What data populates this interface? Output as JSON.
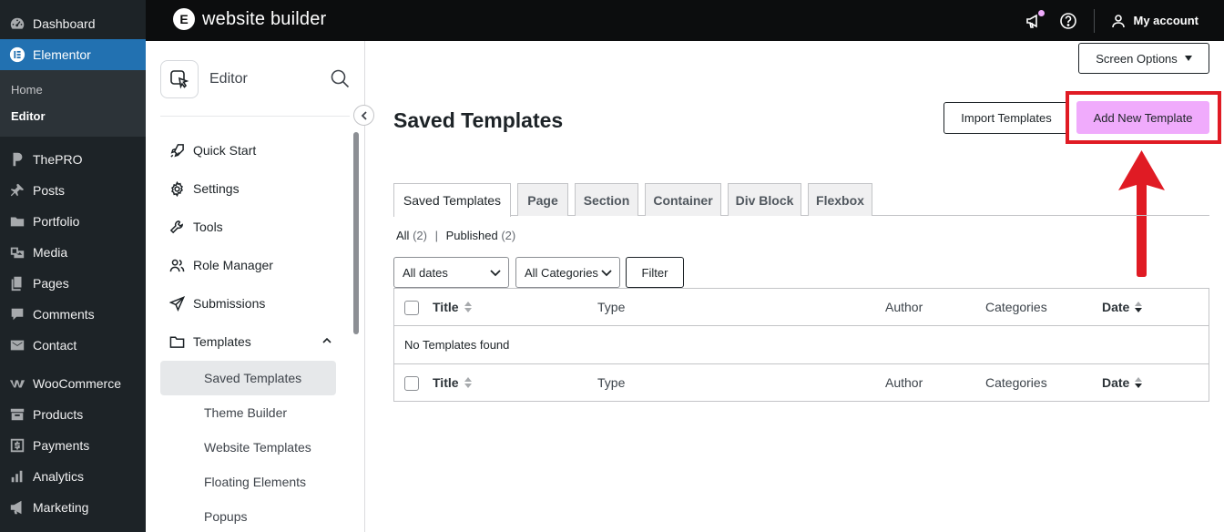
{
  "wp_menu": {
    "dashboard": "Dashboard",
    "elementor": "Elementor",
    "elementor_sub": [
      "Home",
      "Editor"
    ],
    "thepro": "ThePRO",
    "posts": "Posts",
    "portfolio": "Portfolio",
    "media": "Media",
    "pages": "Pages",
    "comments": "Comments",
    "contact": "Contact",
    "woocommerce": "WooCommerce",
    "products": "Products",
    "payments": "Payments",
    "analytics": "Analytics",
    "marketing": "Marketing"
  },
  "topbar": {
    "brand_logo": "E",
    "brand_title": "website builder",
    "account_label": "My account"
  },
  "panel": {
    "title": "Editor",
    "items": [
      "Quick Start",
      "Settings",
      "Tools",
      "Role Manager",
      "Submissions",
      "Templates"
    ],
    "template_sub": [
      "Saved Templates",
      "Theme Builder",
      "Website Templates",
      "Floating Elements",
      "Popups"
    ]
  },
  "main": {
    "screen_options": "Screen Options",
    "title": "Saved Templates",
    "import_label": "Import Templates",
    "add_label": "Add New Template",
    "tabs": [
      "Saved Templates",
      "Page",
      "Section",
      "Container",
      "Div Block",
      "Flexbox"
    ],
    "views": {
      "all": "All",
      "all_count": "(2)",
      "separator": "|",
      "published": "Published",
      "published_count": "(2)"
    },
    "filters": {
      "dates": "All dates",
      "categories": "All Categories",
      "filter_label": "Filter"
    },
    "table": {
      "columns": [
        "Title",
        "Type",
        "Author",
        "Categories",
        "Date"
      ],
      "empty_message": "No Templates found"
    }
  },
  "colors": {
    "wp_sidebar": "#1d2327",
    "wp_active": "#2271b1",
    "add_button": "#f0abfc",
    "highlight": "#e01b24"
  }
}
